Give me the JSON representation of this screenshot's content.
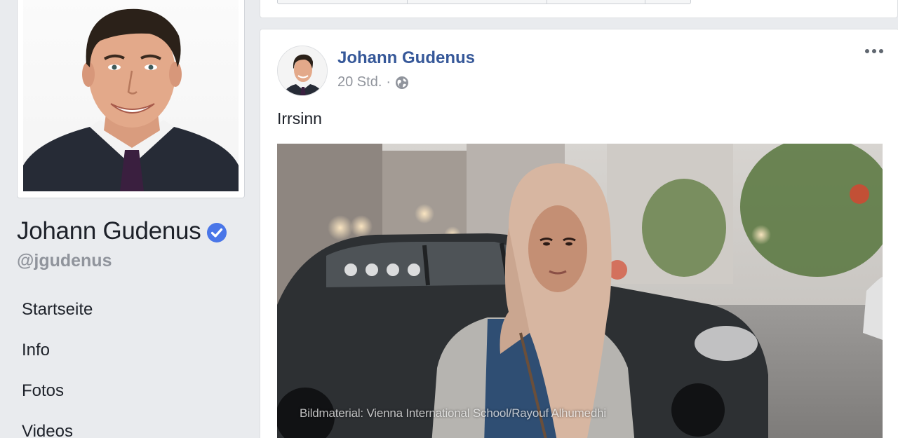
{
  "page": {
    "name": "Johann Gudenus",
    "handle": "@jgudenus",
    "verified": true
  },
  "nav": {
    "items": [
      {
        "label": "Startseite"
      },
      {
        "label": "Info"
      },
      {
        "label": "Fotos"
      },
      {
        "label": "Videos"
      }
    ]
  },
  "post": {
    "author": "Johann Gudenus",
    "time": "20 Std.",
    "separator": "·",
    "privacy_icon": "globe-icon",
    "text": "Irrsinn",
    "image_caption": "Bildmaterial: Vienna International School/Rayouf Alhumedhi"
  },
  "colors": {
    "background": "#e9ebee",
    "link": "#365899",
    "text": "#1d2129",
    "secondary": "#90949c",
    "verified": "#4267b2"
  }
}
